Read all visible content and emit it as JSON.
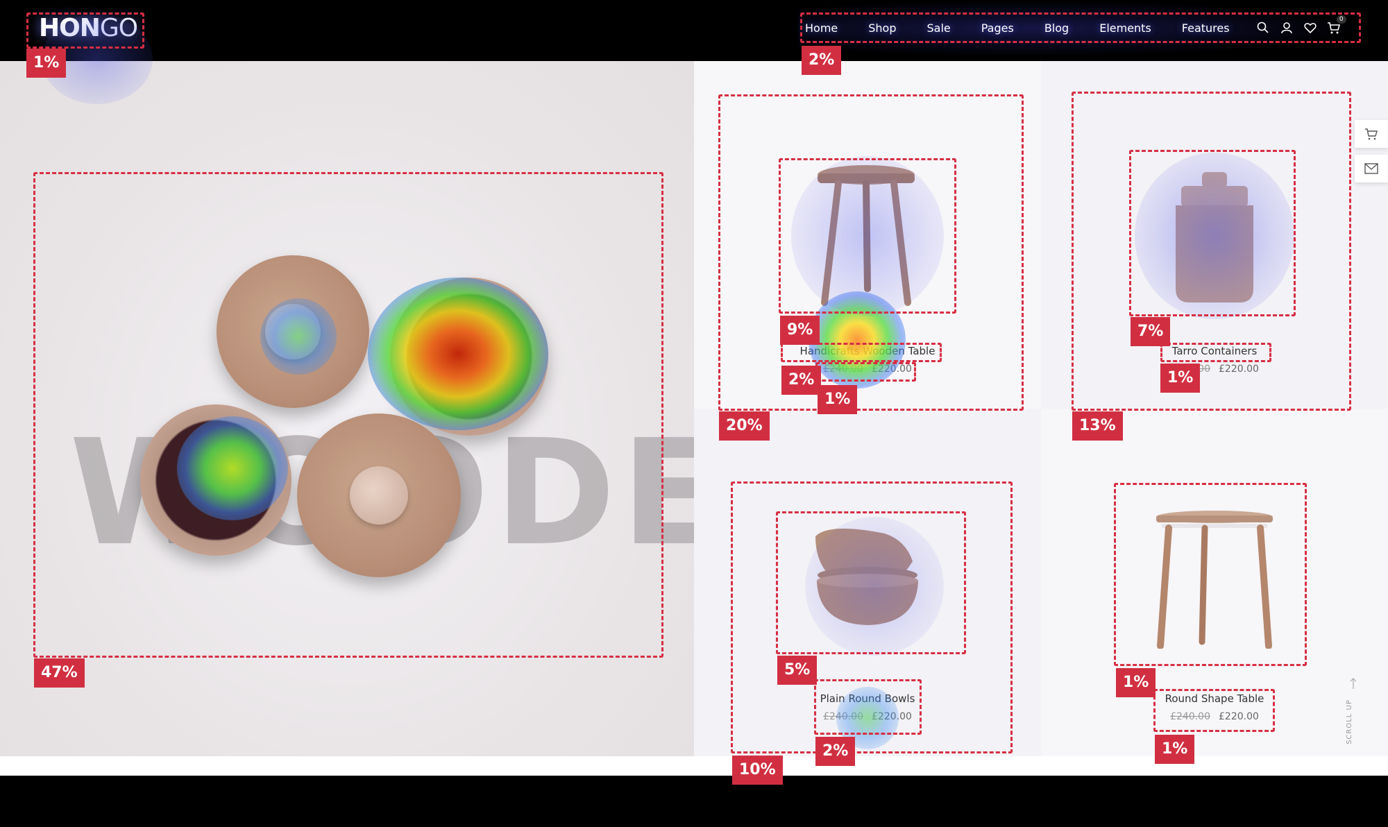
{
  "header": {
    "logo_primary": "HON",
    "logo_secondary": "GO",
    "nav": [
      "Home",
      "Shop",
      "Sale",
      "Pages",
      "Blog",
      "Elements",
      "Features"
    ],
    "icons": [
      "search-icon",
      "user-icon",
      "heart-icon",
      "cart-icon"
    ],
    "cart_count": "0"
  },
  "hero": {
    "word": "WOODEN"
  },
  "products": [
    {
      "title": "Handicrafts Wooden Table",
      "old_price": "£240.00",
      "price": "£220.00"
    },
    {
      "title": "Tarro Containers",
      "old_price": "£240.00",
      "price": "£220.00"
    },
    {
      "title": "Plain Round Bowls",
      "old_price": "£240.00",
      "price": "£220.00"
    },
    {
      "title": "Round Shape Table",
      "old_price": "£240.00",
      "price": "£220.00"
    }
  ],
  "side": {
    "icons": [
      "cart-icon",
      "mail-icon"
    ],
    "scroll_up": "SCROLL UP"
  },
  "heatmap": {
    "colors": {
      "zone": "#d62f43",
      "badge": "#d12f41"
    },
    "zones": [
      {
        "name": "logo-zone",
        "percent": "1%"
      },
      {
        "name": "nav-zone",
        "percent": "2%"
      },
      {
        "name": "hero-zone",
        "percent": "47%"
      },
      {
        "name": "product-1-card-zone",
        "percent": "20%"
      },
      {
        "name": "product-1-image-zone",
        "percent": "9%"
      },
      {
        "name": "product-1-title-zone",
        "percent": "2%"
      },
      {
        "name": "product-1-price-zone",
        "percent": "1%"
      },
      {
        "name": "product-2-card-zone",
        "percent": "13%"
      },
      {
        "name": "product-2-image-zone",
        "percent": "7%"
      },
      {
        "name": "product-2-title-zone",
        "percent": "1%"
      },
      {
        "name": "product-3-card-zone",
        "percent": "10%"
      },
      {
        "name": "product-3-image-zone",
        "percent": "5%"
      },
      {
        "name": "product-3-text-zone",
        "percent": "2%"
      },
      {
        "name": "product-4-image-zone",
        "percent": "1%"
      },
      {
        "name": "product-4-text-zone",
        "percent": "1%"
      }
    ]
  }
}
